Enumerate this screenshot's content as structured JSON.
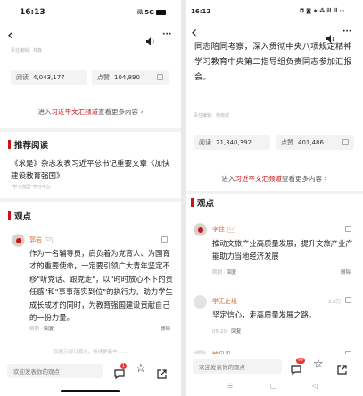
{
  "left": {
    "status": {
      "time": "16:13",
      "network": "5G"
    },
    "nav": {
      "back": "‹",
      "more": "···"
    },
    "editor": "责任编辑：林森",
    "stats": {
      "read_label": "阅读",
      "read_value": "4,043,177",
      "like_label": "点赞",
      "like_value": "104,890"
    },
    "channel_link": {
      "prefix": "进入",
      "highlight": "习近平文汇频道",
      "suffix": "查看更多内容",
      "arrow": "›"
    },
    "recommended": {
      "title": "推荐阅读",
      "items": [
        {
          "title": "《求是》杂志发表习近平总书记重要文章《加快建设教育强国》",
          "source": "\"学习强国\"学习平台"
        }
      ]
    },
    "opinions_title": "观点",
    "comments": [
      {
        "name": "郭岩",
        "level": "Lv",
        "text": "作为一名辅导员，肩负着为党育人、为国育才的重要使命，一定要引领广大青年坚定不移\"听党话、跟党走\"，以\"时时放心不下的责任感\"和\"事事落实到位\"的执行力，助力学生成长成才的同时，为教育强国建设贡献自己的一份力量。",
        "meta_label": "刚刚",
        "reply": "回复",
        "delete": "删除"
      }
    ],
    "footer_hint": "仅展示部分观点，持续更新中……",
    "bottom": {
      "placeholder": "欢迎发表你的观点",
      "badge": "1"
    }
  },
  "right": {
    "status": {
      "time": "16:12",
      "icons": "◘ ◙ ∗ ⁂ 𝗂𝗅𝗅 𝗂𝗅𝗅 ▭"
    },
    "nav": {
      "back": "‹",
      "more": "···"
    },
    "article_tail": "同志陪同考察，深入贯彻中央八项规定精神学习教育中央第二指导组负责同志参加汇报会。",
    "editor": "责任编辑：杨晓成",
    "stats": {
      "read_label": "阅读",
      "read_value": "21,340,392",
      "like_label": "点赞",
      "like_value": "401,486"
    },
    "channel_link": {
      "prefix": "进入",
      "highlight": "习近平文汇频道",
      "suffix": "查看更多内容",
      "arrow": "›"
    },
    "opinions_title": "观点",
    "comments": [
      {
        "name": "李佳",
        "level": "Lv",
        "text": "推动文旅产业高质量发展，提升文旅产业产能助力当地经济发展",
        "meta_label": "刚刚",
        "reply": "回复",
        "delete": "删除"
      },
      {
        "name": "学无止境",
        "likes": "2.3万",
        "text": "坚定信心，走高质量发展之路。",
        "meta_label": "05-20",
        "reply": "回复"
      },
      {
        "name": "敏见乎"
      }
    ],
    "bottom": {
      "placeholder": "欢迎发表你的观点",
      "badge": "99"
    },
    "system_nav": {
      "menu": "☰",
      "home": "▢",
      "back": "◁"
    }
  },
  "colors": {
    "accent_red": "#c8161d",
    "name_orange": "#c96e3b",
    "badge_red": "#e53935"
  }
}
